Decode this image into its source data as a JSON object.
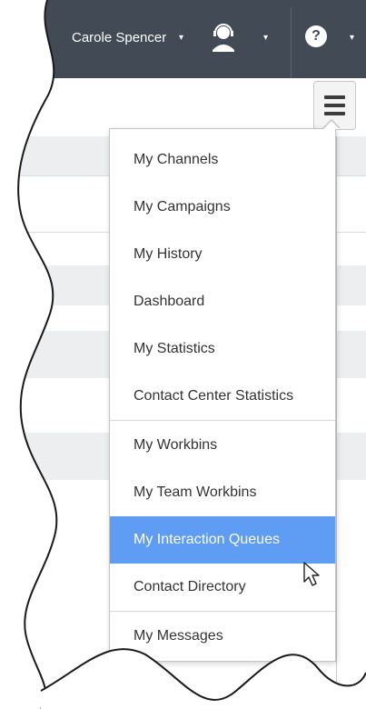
{
  "header": {
    "user_name": "Carole Spencer",
    "user_menu_caret": "▾",
    "agent_status_icon": "agent-headset-icon",
    "agent_status_caret": "▾",
    "help_icon": "?",
    "help_caret": "▾"
  },
  "main_menu": {
    "button_icon": "hamburger-icon",
    "items": [
      {
        "label": "My Channels"
      },
      {
        "label": "My Campaigns"
      },
      {
        "label": "My History"
      },
      {
        "label": "Dashboard"
      },
      {
        "label": "My Statistics"
      },
      {
        "label": "Contact Center Statistics"
      },
      {
        "label": "My Workbins"
      },
      {
        "label": "My Team Workbins"
      },
      {
        "label": "My Interaction Queues",
        "active": true
      },
      {
        "label": "Contact Directory"
      },
      {
        "label": "My Messages"
      }
    ]
  },
  "colors": {
    "topbar": "#424b55",
    "active_item": "#5f9cf3",
    "menu_text": "#333333"
  }
}
